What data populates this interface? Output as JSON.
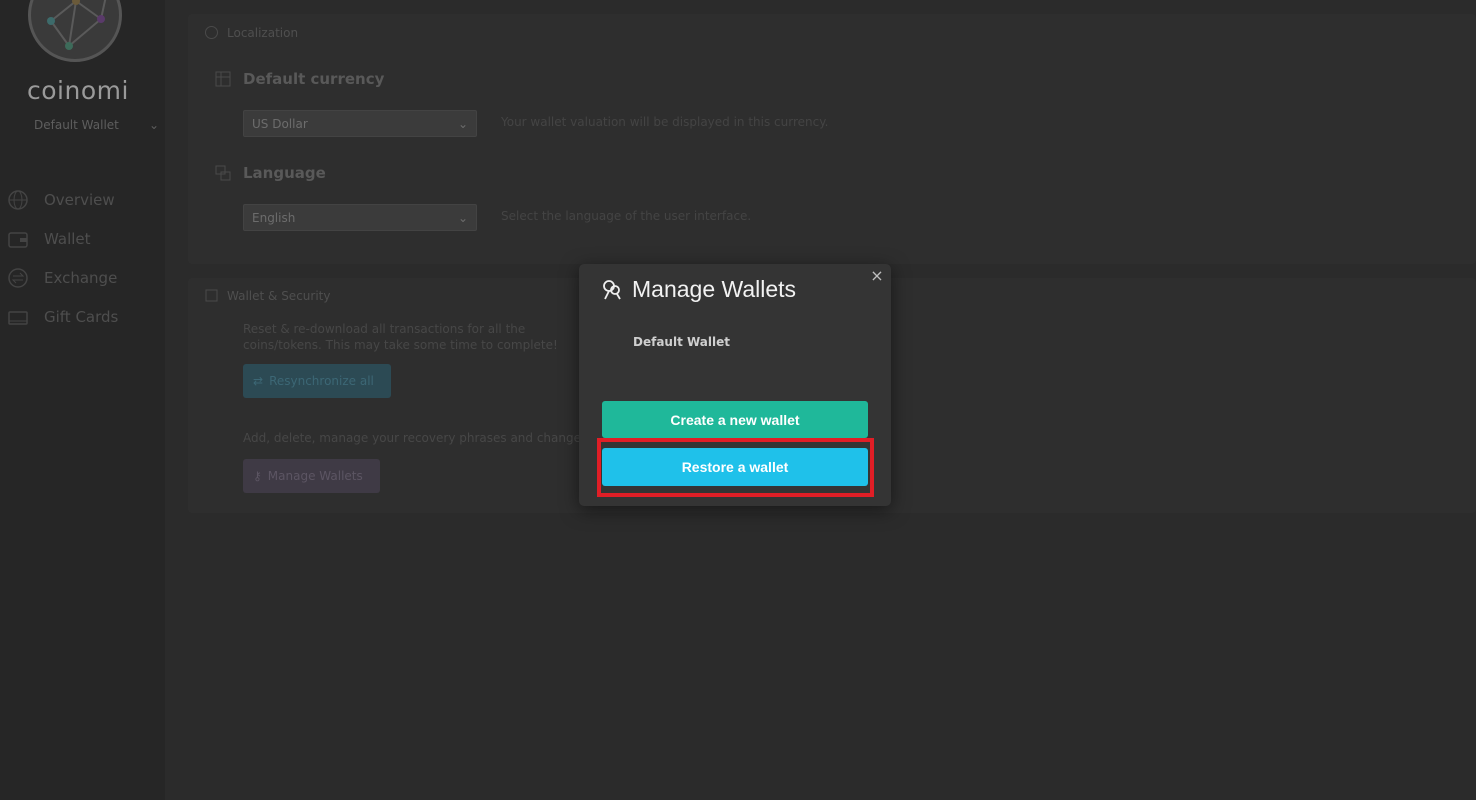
{
  "sidebar": {
    "brand": "coinomi",
    "wallet_selector": "Default Wallet",
    "nav": [
      {
        "label": "Overview",
        "icon": "globe-icon"
      },
      {
        "label": "Wallet",
        "icon": "wallet-icon"
      },
      {
        "label": "Exchange",
        "icon": "exchange-icon"
      },
      {
        "label": "Gift Cards",
        "icon": "gift-card-icon"
      }
    ]
  },
  "localization": {
    "section_title": "Localization",
    "currency_title": "Default currency",
    "currency_value": "US Dollar",
    "currency_hint": "Your wallet valuation will be displayed in this currency.",
    "language_title": "Language",
    "language_value": "English",
    "language_hint": "Select the language of the user interface."
  },
  "security": {
    "section_title": "Wallet & Security",
    "resync_desc": "Reset & re-download all transactions for all the coins/tokens. This may take some time to complete!",
    "resync_label": "Resynchronize all",
    "manage_desc": "Add, delete, manage your recovery phrases and change your passwords.",
    "manage_label": "Manage Wallets"
  },
  "modal": {
    "title": "Manage Wallets",
    "wallet_name": "Default Wallet",
    "create_label": "Create a new wallet",
    "restore_label": "Restore a wallet",
    "close_glyph": "×"
  },
  "colors": {
    "create_button": "#1fb89a",
    "restore_button": "#1fc1ea",
    "highlight": "#e01e26"
  }
}
